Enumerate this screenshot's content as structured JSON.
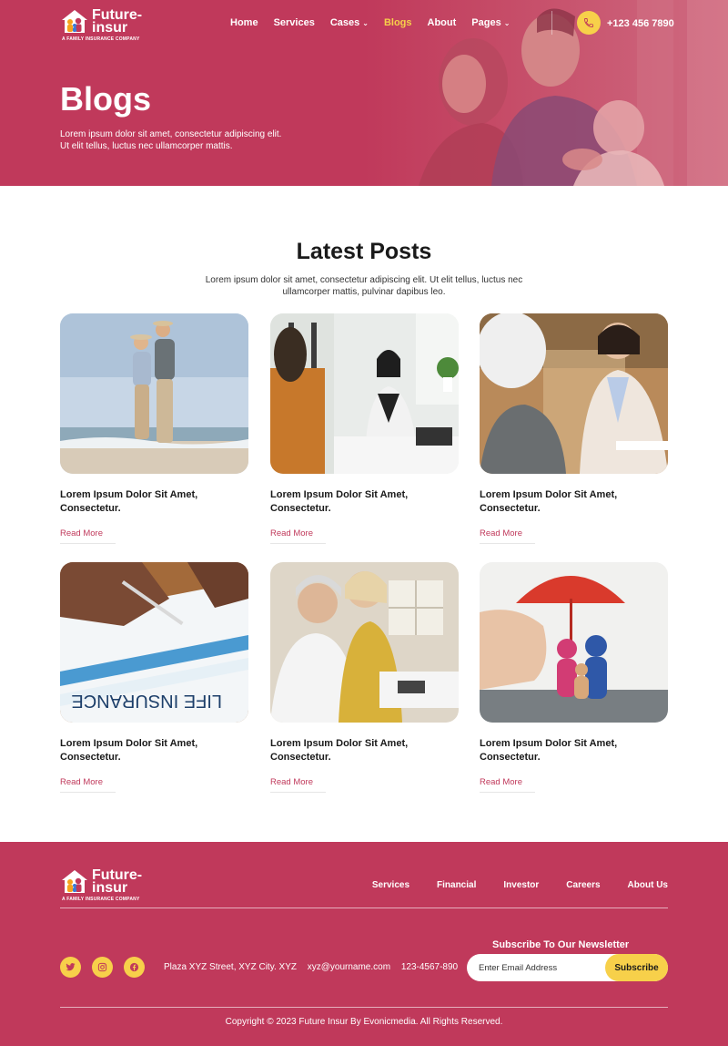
{
  "brand": {
    "name_line1": "Future-",
    "name_line2": "insur",
    "tagline": "A FAMILY INSURANCE COMPANY"
  },
  "nav": {
    "items": [
      {
        "label": "Home",
        "dropdown": false,
        "active": false
      },
      {
        "label": "Services",
        "dropdown": false,
        "active": false
      },
      {
        "label": "Cases",
        "dropdown": true,
        "active": false
      },
      {
        "label": "Blogs",
        "dropdown": false,
        "active": true
      },
      {
        "label": "About",
        "dropdown": false,
        "active": false
      },
      {
        "label": "Pages",
        "dropdown": true,
        "active": false
      }
    ],
    "phone_icon": "phone-icon",
    "phone": "+123 456 7890"
  },
  "hero": {
    "title": "Blogs",
    "subtitle_line1": "Lorem ipsum dolor sit amet, consectetur adipiscing elit.",
    "subtitle_line2": "Ut elit tellus, luctus nec ullamcorper mattis."
  },
  "latest": {
    "title": "Latest Posts",
    "subtitle_line1": "Lorem ipsum dolor sit amet, consectetur adipiscing elit. Ut elit tellus, luctus nec",
    "subtitle_line2": "ullamcorper mattis, pulvinar dapibus leo."
  },
  "posts": [
    {
      "title_line1": "Lorem Ipsum Dolor Sit Amet,",
      "title_line2": "Consectetur.",
      "read_more": "Read More"
    },
    {
      "title_line1": "Lorem Ipsum Dolor Sit Amet,",
      "title_line2": "Consectetur.",
      "read_more": "Read More"
    },
    {
      "title_line1": "Lorem Ipsum Dolor Sit Amet,",
      "title_line2": "Consectetur.",
      "read_more": "Read More"
    },
    {
      "title_line1": "Lorem Ipsum Dolor Sit Amet,",
      "title_line2": "Consectetur.",
      "read_more": "Read More"
    },
    {
      "title_line1": "Lorem Ipsum Dolor Sit Amet,",
      "title_line2": "Consectetur.",
      "read_more": "Read More"
    },
    {
      "title_line1": "Lorem Ipsum Dolor Sit Amet,",
      "title_line2": "Consectetur.",
      "read_more": "Read More"
    }
  ],
  "footer": {
    "links": [
      "Services",
      "Financial",
      "Investor",
      "Careers",
      "About Us"
    ],
    "social_icons": [
      "twitter-icon",
      "instagram-icon",
      "facebook-icon"
    ],
    "address": "Plaza XYZ Street, XYZ City. XYZ",
    "email": "xyz@yourname.com",
    "phone": "123-4567-890",
    "newsletter_title": "Subscribe To Our Newsletter",
    "email_placeholder": "Enter Email Address",
    "subscribe_label": "Subscribe",
    "copyright": "Copyright © 2023 Future Insur By Evonicmedia. All Rights Reserved."
  },
  "colors": {
    "primary": "#c0395b",
    "accent": "#f7d04a",
    "text_dark": "#1a1a1a"
  }
}
